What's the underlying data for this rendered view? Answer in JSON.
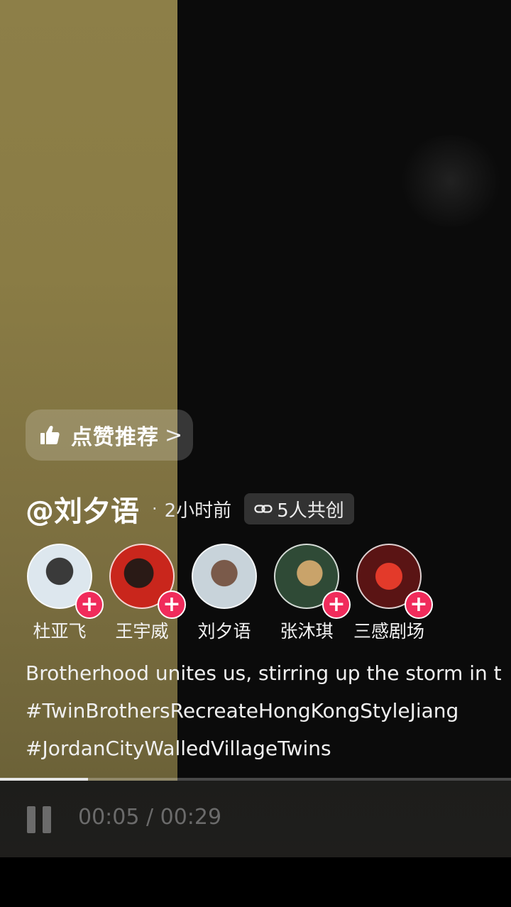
{
  "like_recommend": {
    "label": "点赞推荐",
    "chevron": ">"
  },
  "author": {
    "name": "@刘夕语",
    "dot": "·",
    "posted": "2小时前",
    "cocreate": "5人共创"
  },
  "creators": [
    {
      "name": "杜亚飞",
      "follow": "+",
      "avatar_color": "#c9d7e3"
    },
    {
      "name": "王宇威",
      "follow": "+",
      "avatar_color": "#c4241c"
    },
    {
      "name": "刘夕语",
      "follow": "",
      "avatar_color": "#b9c6cf"
    },
    {
      "name": "张沐琪",
      "follow": "+",
      "avatar_color": "#2e4a34"
    },
    {
      "name": "三感剧场",
      "follow": "+",
      "avatar_color": "#8c1c1c"
    }
  ],
  "caption": {
    "line1": "Brotherhood unites us, stirring up the storm in t",
    "line2": "#TwinBrothersRecreateHongKongStyleJiang",
    "line3": "#JordanCityWalledVillageTwins"
  },
  "player": {
    "time_readout": "00:05 / 00:29",
    "progress_fraction": 0.172,
    "state": "playing"
  },
  "colors": {
    "follow_accent": "#f02b5b",
    "left_pane": "#8a7c45"
  },
  "icons": [
    "thumbs-up-icon",
    "link-icon",
    "pause-icon",
    "plus-icon"
  ]
}
